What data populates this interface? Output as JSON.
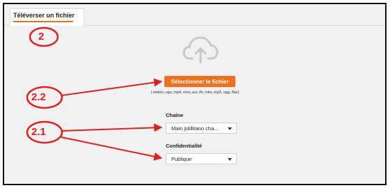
{
  "tabs": [
    {
      "label": "Téléverser un fichier"
    }
  ],
  "upload": {
    "icon": "cloud-upload-icon",
    "button_label": "Sélectionner le fichier",
    "formats": "(.webm,.ogv,.mp4,.mov,.avi,.flv,.mkv,.mp3,.ogg,.flac)"
  },
  "channel": {
    "label": "Chaîne",
    "value": "Main jstillitano cha..."
  },
  "privacy": {
    "label": "Confidentialité",
    "value": "Publique"
  },
  "annotations": [
    "2",
    "2.2",
    "2.1"
  ],
  "colors": {
    "accent": "#f26d1c",
    "annotation": "#e02020",
    "background": "#f1f1f1"
  }
}
